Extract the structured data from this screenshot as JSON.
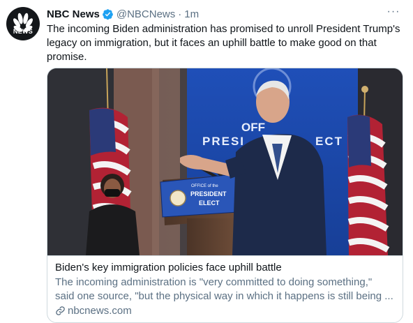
{
  "tweet": {
    "author_name": "NBC News",
    "author_handle": "@NBCNews",
    "separator": "·",
    "time": "1m",
    "more_label": "···",
    "avatar_text": "NEWS",
    "text": "The incoming Biden administration has promised to unroll President Trump's legacy on immigration, but it faces an uphill battle to make good on that promise."
  },
  "card": {
    "photo_lettering": {
      "back_left": "OFF",
      "back_main": "PRESI",
      "back_right": "ECT",
      "back_fragment": "E",
      "podium_line1": "OFFICE of the",
      "podium_line2": "PRESIDENT",
      "podium_line3": "ELECT"
    },
    "title": "Biden's key immigration policies face uphill battle",
    "description_line1": "The incoming administration is \"very committed to doing something,\"",
    "description_line2": "said one source, \"but the physical way in which it happens is still being ...",
    "domain": "nbcnews.com"
  },
  "colors": {
    "verified": "#1da1f2",
    "secondary_text": "#5b7083",
    "border": "#cfd9de",
    "backdrop_blue": "#1e4fb5",
    "podium_blue": "#2a56b8"
  },
  "icons": [
    "nbc-peacock-icon",
    "verified-badge-icon",
    "more-options-icon",
    "link-icon"
  ]
}
